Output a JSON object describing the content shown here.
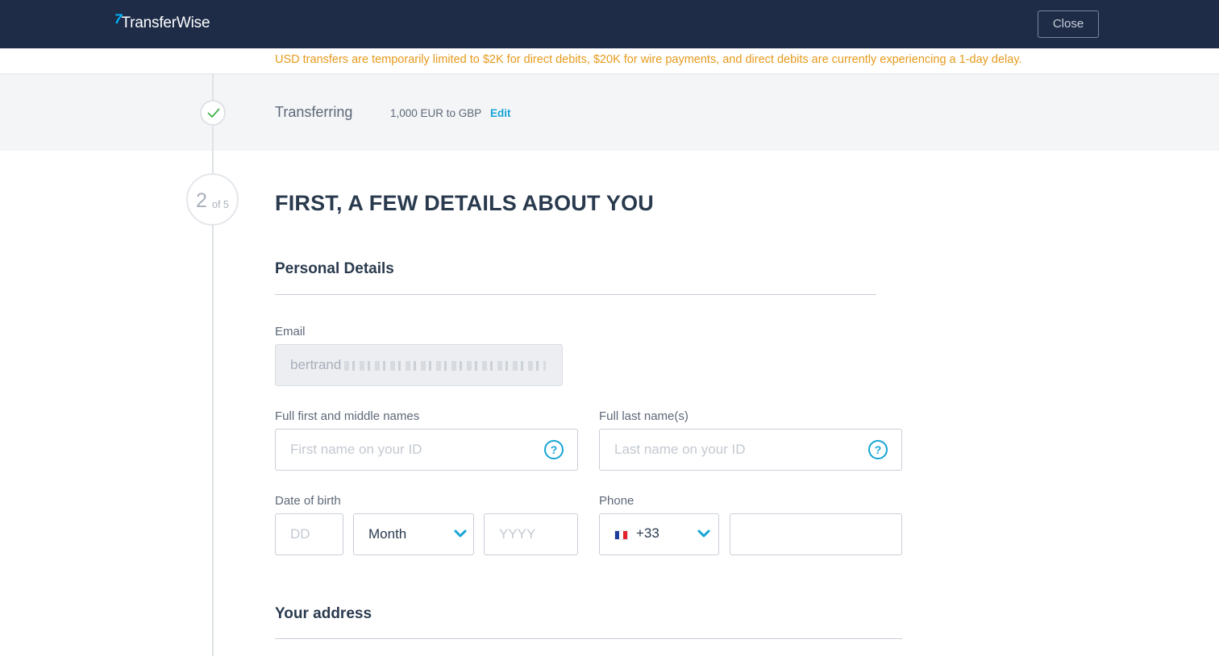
{
  "header": {
    "brand": "TransferWise",
    "logo_mark": "7",
    "close_label": "Close"
  },
  "notice": "USD transfers are temporarily limited to $2K for direct debits, $20K for wire payments, and direct debits are currently experiencing a 1-day delay.",
  "completed_step": {
    "label": "Transferring",
    "value": "1,000 EUR to GBP",
    "edit_label": "Edit",
    "icon": "check-icon"
  },
  "current_step": {
    "number": "2",
    "of_total": "of 5",
    "title": "FIRST, A FEW DETAILS ABOUT YOU"
  },
  "personal_details": {
    "section_title": "Personal Details",
    "email_label": "Email",
    "email_value": "bertrand",
    "first_names_label": "Full first and middle names",
    "first_names_placeholder": "First name on your ID",
    "last_names_label": "Full last name(s)",
    "last_names_placeholder": "Last name on your ID",
    "help_icon": "?",
    "dob_label": "Date of birth",
    "dob_day_placeholder": "DD",
    "dob_month_value": "Month",
    "dob_year_placeholder": "YYYY",
    "phone_label": "Phone",
    "phone_code": "+33",
    "phone_flag": "france-flag-icon",
    "phone_number_value": ""
  },
  "address": {
    "section_title": "Your address"
  },
  "colors": {
    "header_bg": "#1e2c47",
    "accent": "#16a5d5",
    "notice_text": "#e69a1c",
    "success": "#3fb54b"
  }
}
